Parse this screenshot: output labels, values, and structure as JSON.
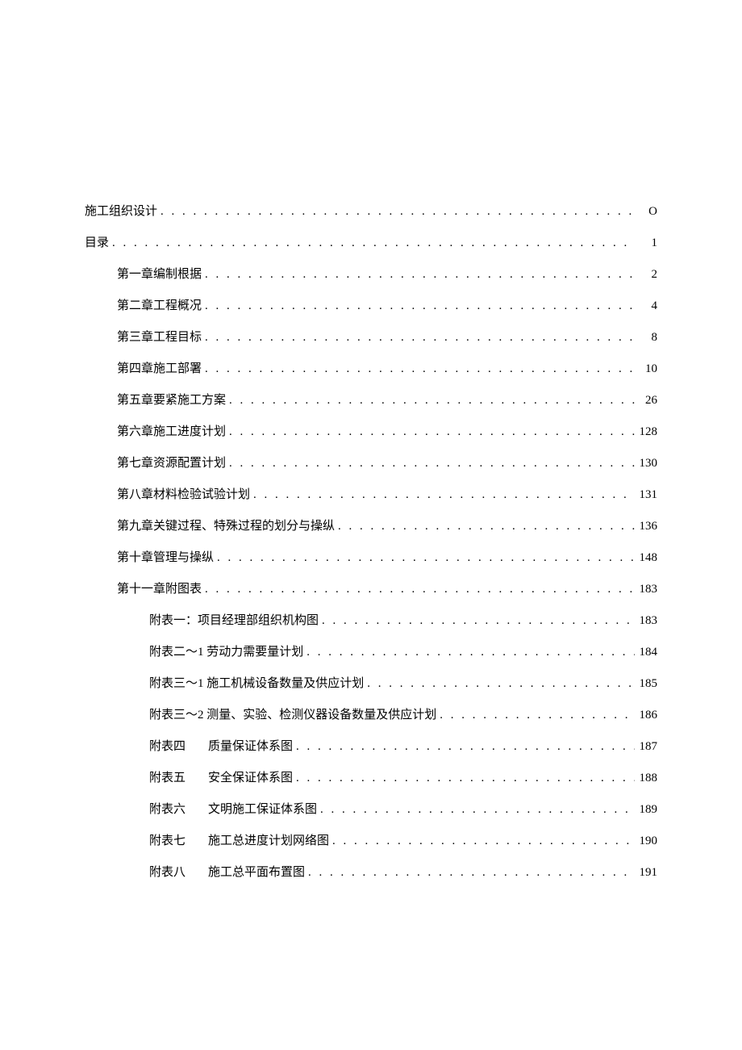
{
  "toc": {
    "entries": [
      {
        "level": 0,
        "label": "施工组织设计",
        "page": "O"
      },
      {
        "level": 0,
        "label": "目录",
        "page": "1"
      },
      {
        "level": 1,
        "label": "第一章编制根据",
        "page": "2"
      },
      {
        "level": 1,
        "label": "第二章工程概况",
        "page": "4"
      },
      {
        "level": 1,
        "label": "第三章工程目标",
        "page": "8"
      },
      {
        "level": 1,
        "label": "第四章施工部署",
        "page": "10"
      },
      {
        "level": 1,
        "label": "第五章要紧施工方案",
        "page": "26"
      },
      {
        "level": 1,
        "label": "第六章施工进度计划",
        "page": "128"
      },
      {
        "level": 1,
        "label": "第七章资源配置计划",
        "page": "130"
      },
      {
        "level": 1,
        "label": "第八章材料检验试验计划",
        "page": "131"
      },
      {
        "level": 1,
        "label": "第九章关键过程、特殊过程的划分与操纵",
        "page": "136"
      },
      {
        "level": 1,
        "label": "第十章管理与操纵",
        "page": "148"
      },
      {
        "level": 1,
        "label": "第十一章附图表",
        "page": "183"
      },
      {
        "level": 2,
        "label": "附表一：项目经理部组织机构图",
        "page": "183"
      },
      {
        "level": 2,
        "label": "附表二～1 劳动力需要量计划",
        "page": "184"
      },
      {
        "level": 2,
        "label": "附表三～1 施工机械设备数量及供应计划",
        "page": "185"
      },
      {
        "level": 2,
        "label": "附表三～2 测量、实验、检测仪器设备数量及供应计划",
        "page": "186"
      },
      {
        "level": 2,
        "label": "附表四",
        "label2": "质量保证体系图",
        "page": "187",
        "split": true
      },
      {
        "level": 2,
        "label": "附表五",
        "label2": "安全保证体系图",
        "page": "188",
        "split": true
      },
      {
        "level": 2,
        "label": "附表六",
        "label2": "文明施工保证体系图",
        "page": "189",
        "split": true
      },
      {
        "level": 2,
        "label": "附表七",
        "label2": "施工总进度计划网络图",
        "page": "190",
        "split": true
      },
      {
        "level": 2,
        "label": "附表八",
        "label2": "施工总平面布置图",
        "page": "191",
        "split": true
      }
    ]
  }
}
